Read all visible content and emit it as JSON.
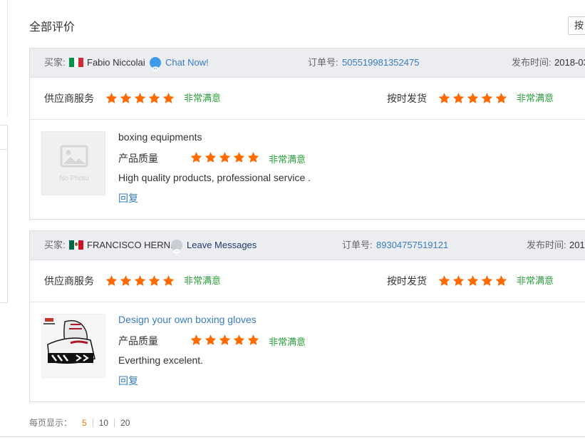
{
  "page": {
    "title": "全部评价",
    "sort_label": "按"
  },
  "colors": {
    "star": "#ff6a00",
    "satisfied": "#2ba23a",
    "link": "#3a7cc4"
  },
  "labels": {
    "buyer": "买家:",
    "order": "订单号:",
    "published": "发布时间:",
    "supplier_service": "供应商服务",
    "on_time_delivery": "按时发货",
    "product_quality": "产品质量",
    "reply": "回复"
  },
  "reviews": [
    {
      "buyer_name": "Fabio Niccolai",
      "country_flag": "italy-flag-icon",
      "contact_label": "Chat Now!",
      "order_number": "505519981352475",
      "published_time": "2018-03",
      "supplier_service_rating": 5,
      "supplier_service_text": "非常满意",
      "delivery_rating": 5,
      "delivery_text": "非常满意",
      "product_title": "boxing equipments",
      "product_image": "no-photo-placeholder",
      "product_image_text": "No Photo",
      "quality_rating": 5,
      "quality_text": "非常满意",
      "comment": "High quality products, professional service ."
    },
    {
      "buyer_name": "FRANCISCO HERN...",
      "country_flag": "mexico-flag-icon",
      "contact_label": "Leave Messages",
      "order_number": "89304757519121",
      "published_time": "201",
      "supplier_service_rating": 5,
      "supplier_service_text": "非常满意",
      "delivery_rating": 5,
      "delivery_text": "非常满意",
      "product_title": "Design your own boxing gloves",
      "product_image": "boxing-gloves-photo",
      "quality_rating": 5,
      "quality_text": "非常满意",
      "comment": "Everthing excelent."
    }
  ],
  "pagination": {
    "label": "每页显示：",
    "options": [
      "5",
      "10",
      "20"
    ],
    "selected": "5"
  }
}
